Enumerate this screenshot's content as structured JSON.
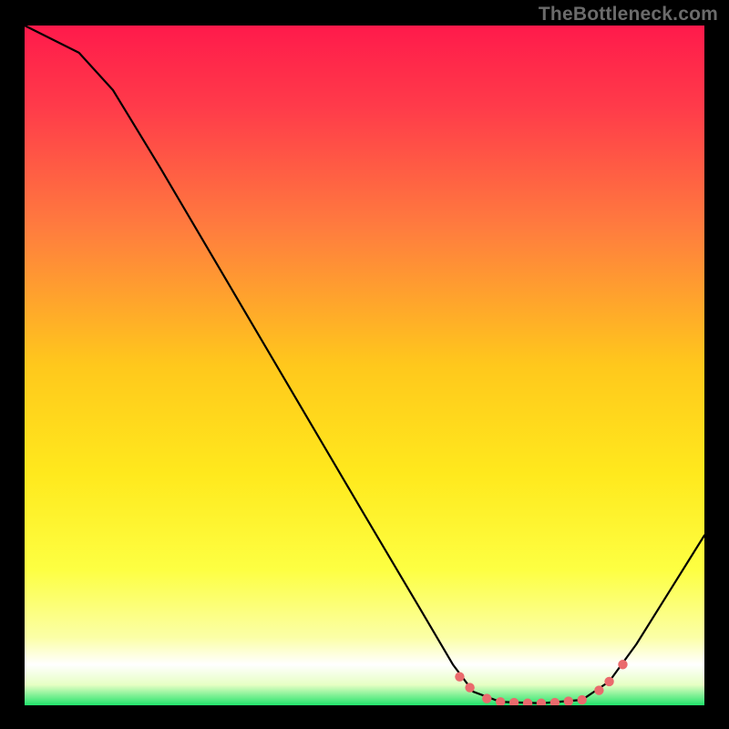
{
  "watermark": "TheBottleneck.com",
  "chart_data": {
    "type": "line",
    "title": "",
    "xlabel": "",
    "ylabel": "",
    "xlim": [
      0,
      100
    ],
    "ylim": [
      0,
      100
    ],
    "background_gradient": [
      {
        "stop": 0.0,
        "color": "#ff1a4b"
      },
      {
        "stop": 0.12,
        "color": "#ff3b4a"
      },
      {
        "stop": 0.3,
        "color": "#ff7d3e"
      },
      {
        "stop": 0.5,
        "color": "#ffc81c"
      },
      {
        "stop": 0.66,
        "color": "#ffe91d"
      },
      {
        "stop": 0.8,
        "color": "#fdff42"
      },
      {
        "stop": 0.9,
        "color": "#fbffa6"
      },
      {
        "stop": 0.94,
        "color": "#ffffff"
      },
      {
        "stop": 0.97,
        "color": "#e6ffc3"
      },
      {
        "stop": 1.0,
        "color": "#21e36b"
      }
    ],
    "series": [
      {
        "name": "curve",
        "stroke": "#000000",
        "stroke_width": 2.2,
        "points": [
          {
            "x": 0.0,
            "y": 100.0
          },
          {
            "x": 8.0,
            "y": 96.0
          },
          {
            "x": 13.0,
            "y": 90.5
          },
          {
            "x": 20.0,
            "y": 79.0
          },
          {
            "x": 30.0,
            "y": 62.0
          },
          {
            "x": 40.0,
            "y": 45.0
          },
          {
            "x": 50.0,
            "y": 28.0
          },
          {
            "x": 58.0,
            "y": 14.5
          },
          {
            "x": 63.0,
            "y": 6.0
          },
          {
            "x": 66.0,
            "y": 2.0
          },
          {
            "x": 70.0,
            "y": 0.5
          },
          {
            "x": 76.0,
            "y": 0.3
          },
          {
            "x": 82.0,
            "y": 0.8
          },
          {
            "x": 86.0,
            "y": 3.5
          },
          {
            "x": 90.0,
            "y": 9.0
          },
          {
            "x": 95.0,
            "y": 17.0
          },
          {
            "x": 100.0,
            "y": 25.0
          }
        ]
      }
    ],
    "markers": {
      "color": "#ea6a6d",
      "radius": 5.2,
      "points": [
        {
          "x": 64.0,
          "y": 4.2
        },
        {
          "x": 65.5,
          "y": 2.6
        },
        {
          "x": 68.0,
          "y": 1.0
        },
        {
          "x": 70.0,
          "y": 0.5
        },
        {
          "x": 72.0,
          "y": 0.4
        },
        {
          "x": 74.0,
          "y": 0.3
        },
        {
          "x": 76.0,
          "y": 0.3
        },
        {
          "x": 78.0,
          "y": 0.4
        },
        {
          "x": 80.0,
          "y": 0.6
        },
        {
          "x": 82.0,
          "y": 0.8
        },
        {
          "x": 84.5,
          "y": 2.2
        },
        {
          "x": 86.0,
          "y": 3.5
        },
        {
          "x": 88.0,
          "y": 6.0
        }
      ]
    }
  }
}
